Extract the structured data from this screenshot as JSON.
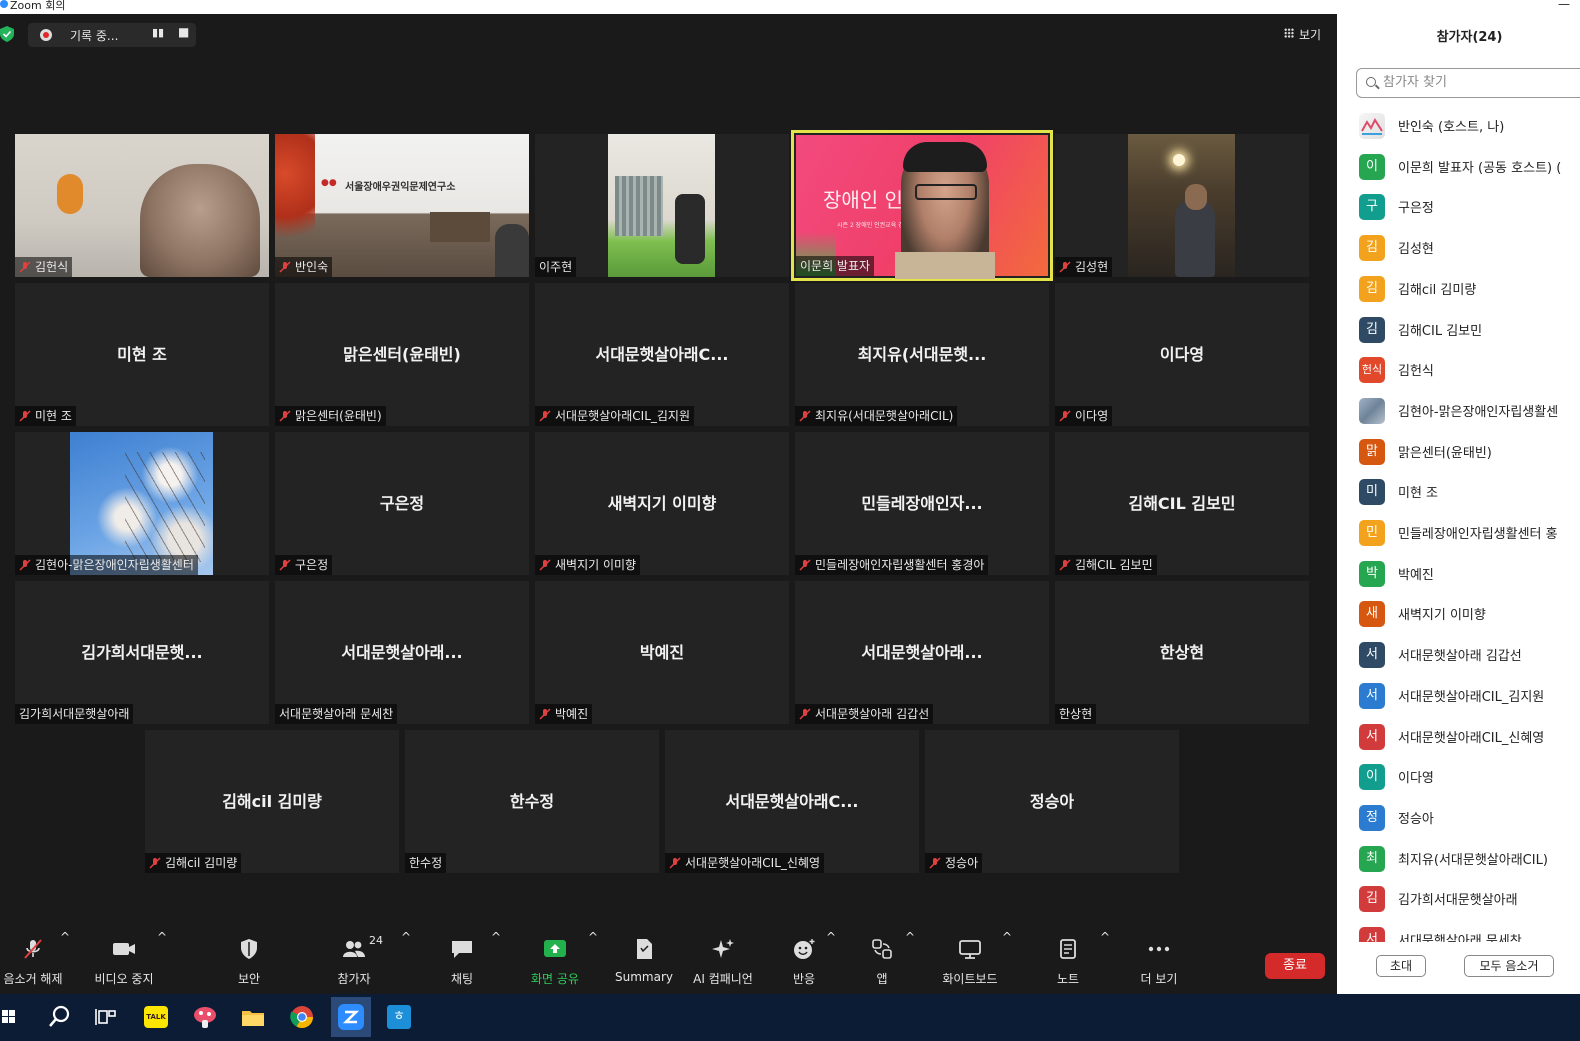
{
  "window": {
    "title": "Zoom 회의"
  },
  "recording": {
    "label": "기록 중...",
    "pause": "▮▮",
    "stop": "■"
  },
  "view": {
    "label": "보기"
  },
  "tiles": {
    "r1": [
      {
        "tag": "김헌식",
        "muted": true
      },
      {
        "tag": "반인숙",
        "muted": true
      },
      {
        "tag": "이주현",
        "muted": false
      },
      {
        "tag": "이문희 발표자",
        "muted": false
      },
      {
        "tag": "김성현",
        "muted": true
      }
    ],
    "r2": [
      {
        "center": "미현 조",
        "tag": "미현 조",
        "muted": true
      },
      {
        "center": "맑은센터(윤태빈)",
        "tag": "맑은센터(윤태빈)",
        "muted": true
      },
      {
        "center": "서대문햇살아래C...",
        "tag": "서대문햇살아래CIL_김지원",
        "muted": true
      },
      {
        "center": "최지유(서대문햇...",
        "tag": "최지유(서대문햇살아래CIL)",
        "muted": true
      },
      {
        "center": "이다영",
        "tag": "이다영",
        "muted": true
      }
    ],
    "r3": [
      {
        "tag": "김현아-맑은장애인자립생활센터",
        "muted": true
      },
      {
        "center": "구은정",
        "tag": "구은정",
        "muted": true
      },
      {
        "center": "새벽지기 이미향",
        "tag": "새벽지기 이미향",
        "muted": true
      },
      {
        "center": "민들레장애인자...",
        "tag": "민들레장애인자립생활센터 홍경아",
        "muted": true
      },
      {
        "center": "김해CIL 김보민",
        "tag": "김해CIL 김보민",
        "muted": true
      }
    ],
    "r4": [
      {
        "center": "김가희서대문햇...",
        "tag": "김가희서대문햇살아래",
        "muted": false
      },
      {
        "center": "서대문햇살아래...",
        "tag": "서대문햇살아래 문세찬",
        "muted": false
      },
      {
        "center": "박예진",
        "tag": "박예진",
        "muted": true
      },
      {
        "center": "서대문햇살아래...",
        "tag": "서대문햇살아래 김갑선",
        "muted": true
      },
      {
        "center": "한상현",
        "tag": "한상현",
        "muted": false
      }
    ],
    "r5": [
      {
        "center": "김해cil 김미량",
        "tag": "김해cil 김미량",
        "muted": true
      },
      {
        "center": "한수정",
        "tag": "한수정",
        "muted": false
      },
      {
        "center": "서대문햇살아래C...",
        "tag": "서대문햇살아래CIL_신혜영",
        "muted": true
      },
      {
        "center": "정승아",
        "tag": "정승아",
        "muted": true
      }
    ]
  },
  "video_texts": {
    "banner": "서울장애우권익문제연구소",
    "slide": "장애인 인      미",
    "slide_sub": "시즌 2 장애인 인권교육 강사      업"
  },
  "toolbar": {
    "unmute": "음소거 해제",
    "video": "비디오 중지",
    "security": "보안",
    "participants": "참가자",
    "participants_count": "24",
    "chat": "채팅",
    "share": "화면 공유",
    "summary": "Summary",
    "ai": "AI 컴패니언",
    "react": "반응",
    "apps": "앱",
    "whiteboard": "화이트보드",
    "notes": "노트",
    "more": "더 보기",
    "end": "종료"
  },
  "panel": {
    "title": "참가자(24)",
    "search_placeholder": "참가자 찾기",
    "invite": "초대",
    "mute_all": "모두 음소거",
    "participants": [
      {
        "initial": "",
        "name": "반인숙 (호스트, 나)",
        "color": "#ffffff"
      },
      {
        "initial": "이",
        "name": "이문희 발표자 (공동 호스트) (",
        "color": "#27a652"
      },
      {
        "initial": "구",
        "name": "구은정",
        "color": "#129e8e"
      },
      {
        "initial": "김",
        "name": "김성현",
        "color": "#f2a21c"
      },
      {
        "initial": "김",
        "name": "김해cil 김미량",
        "color": "#f2a21c"
      },
      {
        "initial": "김",
        "name": "김해CIL 김보민",
        "color": "#2e4a64"
      },
      {
        "initial": "헌식",
        "name": "김헌식",
        "color": "#e2492b"
      },
      {
        "initial": "",
        "name": "김현아-맑은장애인자립생활센",
        "color": "#8fa3b8"
      },
      {
        "initial": "맑",
        "name": "맑은센터(윤태빈)",
        "color": "#d6570f"
      },
      {
        "initial": "미",
        "name": "미현 조",
        "color": "#2e4a64"
      },
      {
        "initial": "민",
        "name": "민들레장애인자립생활센터 홍",
        "color": "#f2a21c"
      },
      {
        "initial": "박",
        "name": "박예진",
        "color": "#27a652"
      },
      {
        "initial": "새",
        "name": "새벽지기 이미향",
        "color": "#d6570f"
      },
      {
        "initial": "서",
        "name": "서대문햇살아래 김갑선",
        "color": "#2e4a64"
      },
      {
        "initial": "서",
        "name": "서대문햇살아래CIL_김지원",
        "color": "#2b7bd0"
      },
      {
        "initial": "서",
        "name": "서대문햇살아래CIL_신혜영",
        "color": "#d23b3b"
      },
      {
        "initial": "이",
        "name": "이다영",
        "color": "#129e8e"
      },
      {
        "initial": "정",
        "name": "정승아",
        "color": "#2b7bd0"
      },
      {
        "initial": "최",
        "name": "최지유(서대문햇살아래CIL)",
        "color": "#27a652"
      },
      {
        "initial": "김",
        "name": "김가희서대문햇살아래",
        "color": "#d23b3b"
      },
      {
        "initial": "서",
        "name": "서대문햇살아래 문세찬",
        "color": "#d23b3b"
      }
    ]
  },
  "taskbar": {
    "apps": [
      "windows-start",
      "search",
      "task-view",
      "kakaotalk",
      "app-mushroom",
      "file-explorer",
      "chrome",
      "zoom",
      "hangul"
    ],
    "kakaotalk_label": "TALK",
    "hangul_label": "ㅎ"
  }
}
